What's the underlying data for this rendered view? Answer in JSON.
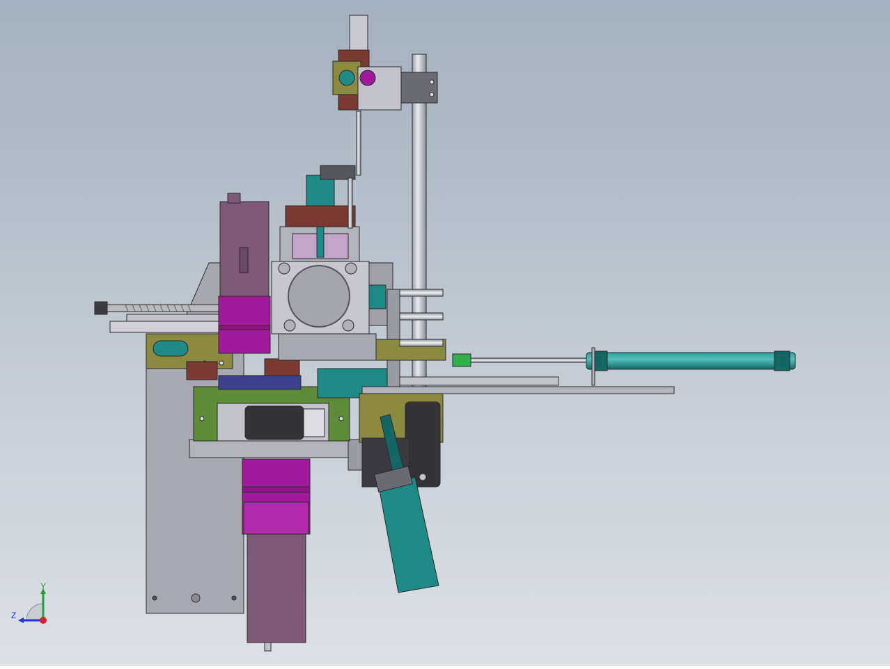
{
  "viewport": {
    "background_top": "#a4b0bd",
    "background_bottom": "#dde1e6"
  },
  "triad": {
    "x_label": "",
    "y_label": "Y",
    "z_label": "Z",
    "x_color": "#d4242b",
    "y_color": "#1fa133",
    "z_color": "#2032d2"
  },
  "model": {
    "icon": "cad-assembly-icon",
    "colors": {
      "frame_grey": "#9a9aa4",
      "light_grey": "#c3c3cb",
      "magenta": "#a21a9c",
      "mauve": "#7d5976",
      "teal": "#1e8a86",
      "olive": "#8c8a40",
      "green": "#5f8a38",
      "maroon": "#7a3a33",
      "navy": "#3c3f8c",
      "dark": "#333338"
    }
  }
}
